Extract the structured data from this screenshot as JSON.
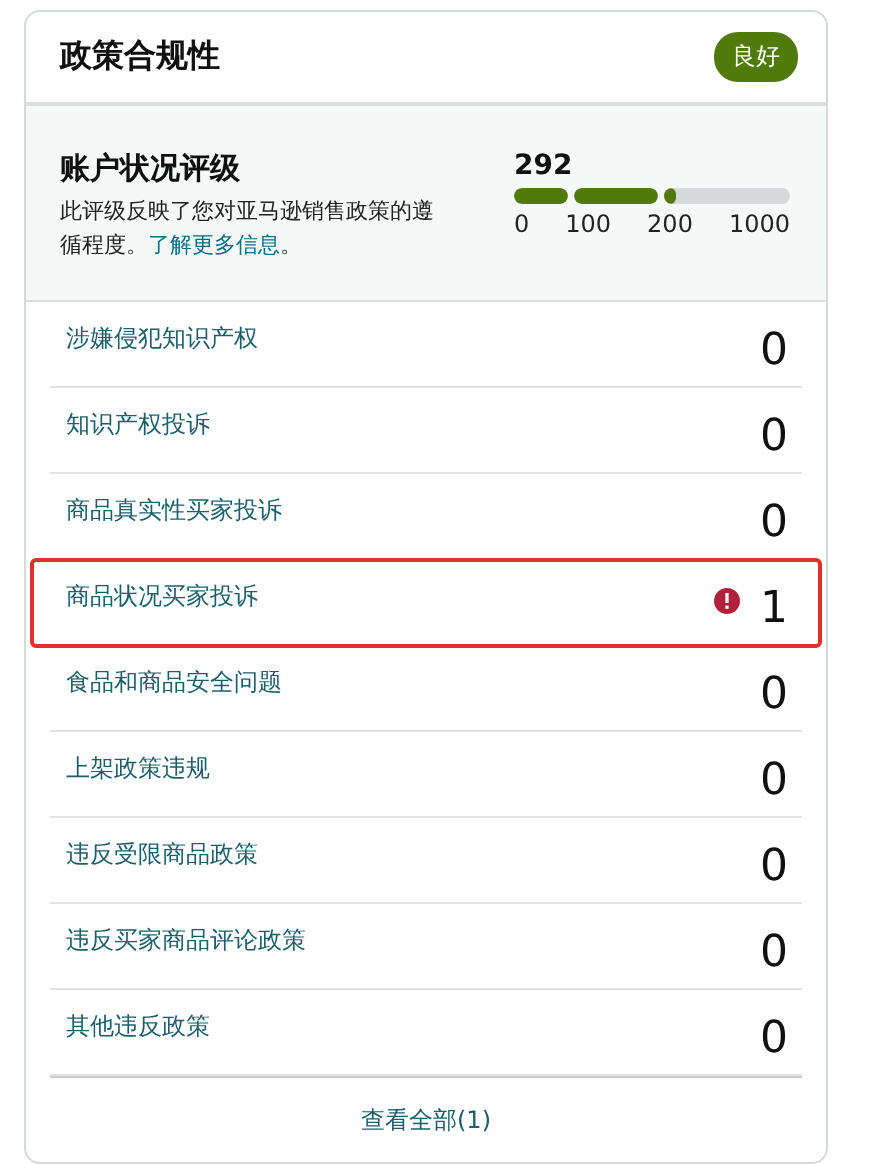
{
  "header": {
    "title": "政策合规性",
    "badge": "良好"
  },
  "rating": {
    "title": "账户状况评级",
    "description": "此评级反映了您对亚马逊销售政策的遵循程度。",
    "link": "了解更多信息",
    "after_link": "。",
    "score": "292",
    "segments": [
      {
        "level": 1
      },
      {
        "level": 1
      },
      {
        "level": 0.1
      }
    ],
    "ticks": [
      "0",
      "100",
      "200",
      "1000"
    ]
  },
  "rows": [
    {
      "label": "涉嫌侵犯知识产权",
      "count": "0",
      "alert": false,
      "highlighted": false
    },
    {
      "label": "知识产权投诉",
      "count": "0",
      "alert": false,
      "highlighted": false
    },
    {
      "label": "商品真实性买家投诉",
      "count": "0",
      "alert": false,
      "highlighted": false
    },
    {
      "label": "商品状况买家投诉",
      "count": "1",
      "alert": true,
      "highlighted": true
    },
    {
      "label": "食品和商品安全问题",
      "count": "0",
      "alert": false,
      "highlighted": false
    },
    {
      "label": "上架政策违规",
      "count": "0",
      "alert": false,
      "highlighted": false
    },
    {
      "label": "违反受限商品政策",
      "count": "0",
      "alert": false,
      "highlighted": false
    },
    {
      "label": "违反买家商品评论政策",
      "count": "0",
      "alert": false,
      "highlighted": false
    },
    {
      "label": "其他违反政策",
      "count": "0",
      "alert": false,
      "highlighted": false
    }
  ],
  "footer": {
    "link": "查看全部(1)"
  }
}
